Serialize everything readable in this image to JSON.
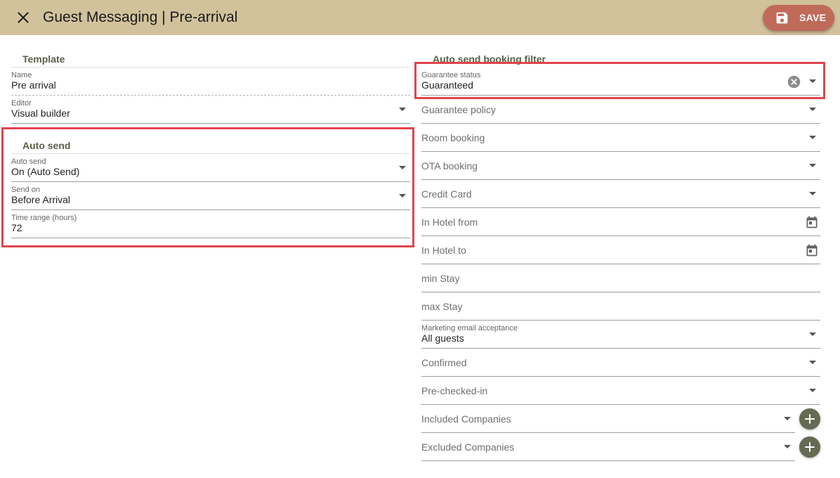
{
  "header": {
    "title": "Guest Messaging | Pre-arrival",
    "save_label": "SAVE"
  },
  "template": {
    "section_title": "Template",
    "name": {
      "label": "Name",
      "value": "Pre arrival"
    },
    "editor": {
      "label": "Editor",
      "value": "Visual builder"
    }
  },
  "auto_send": {
    "section_title": "Auto send",
    "auto_send": {
      "label": "Auto send",
      "value": "On (Auto Send)"
    },
    "send_on": {
      "label": "Send on",
      "value": "Before Arrival"
    },
    "time_range": {
      "label": "Time range (hours)",
      "value": "72"
    }
  },
  "filter": {
    "section_title": "Auto send booking filter",
    "guarantee_status": {
      "label": "Guarantee status",
      "value": "Guaranteed"
    },
    "guarantee_policy": "Guarantee policy",
    "room_booking": "Room booking",
    "ota_booking": "OTA booking",
    "credit_card": "Credit Card",
    "in_hotel_from": "In Hotel from",
    "in_hotel_to": "In Hotel to",
    "min_stay": "min Stay",
    "max_stay": "max Stay",
    "marketing_email": {
      "label": "Marketing email acceptance",
      "value": "All guests"
    },
    "confirmed": "Confirmed",
    "pre_checked_in": "Pre-checked-in",
    "included_companies": "Included Companies",
    "excluded_companies": "Excluded Companies"
  },
  "colors": {
    "header_bg": "#d2c29c",
    "save_button": "#c06a5a",
    "section_title": "#5a6048",
    "add_button": "#636b53",
    "highlight": "#e0454d"
  },
  "icons": [
    "close-icon",
    "save-icon",
    "chevron-down-icon",
    "clear-icon",
    "calendar-icon",
    "plus-icon"
  ]
}
